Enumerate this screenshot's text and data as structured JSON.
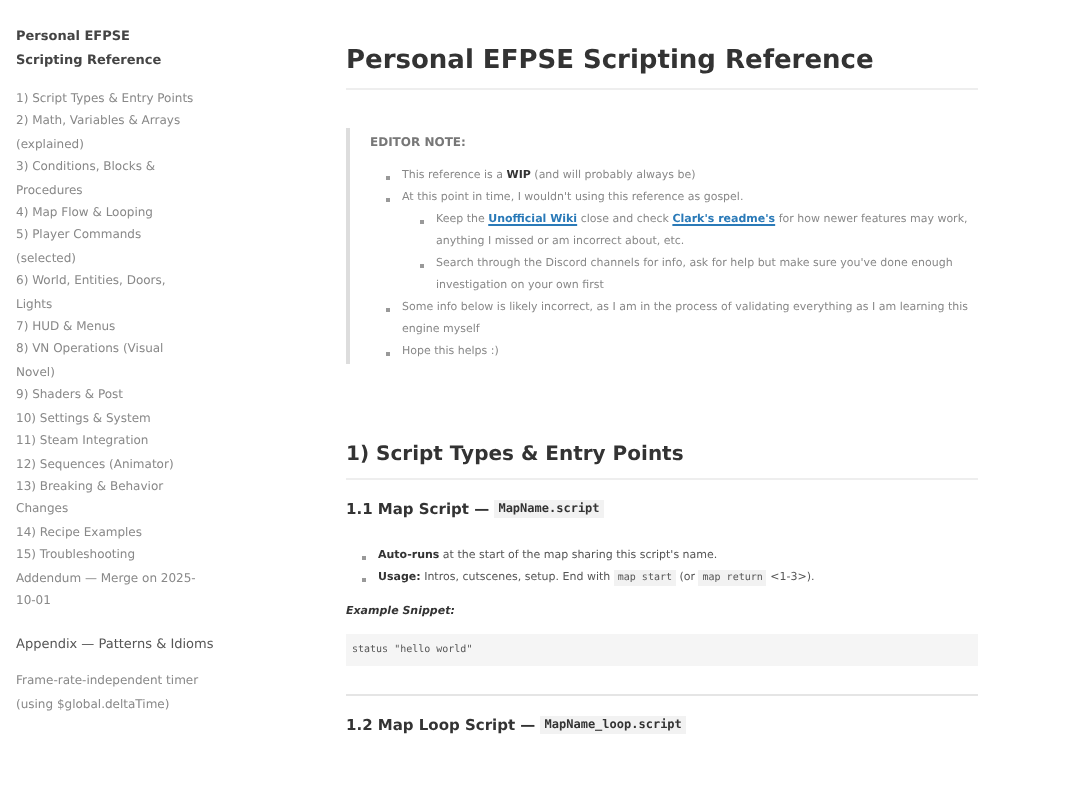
{
  "sidebar": {
    "title": "Personal EFPSE Scripting Reference",
    "items": [
      {
        "label": "1) Script Types & Entry Points"
      },
      {
        "label": "2) Math, Variables & Arrays (explained)"
      },
      {
        "label": "3) Conditions, Blocks & Procedures"
      },
      {
        "label": "4) Map Flow & Looping"
      },
      {
        "label": "5) Player Commands (selected)"
      },
      {
        "label": "6) World, Entities, Doors, Lights"
      },
      {
        "label": "7) HUD & Menus"
      },
      {
        "label": "8) VN Operations (Visual Novel)"
      },
      {
        "label": "9) Shaders & Post"
      },
      {
        "label": "10) Settings & System"
      },
      {
        "label": "11) Steam Integration"
      },
      {
        "label": "12) Sequences (Animator)"
      },
      {
        "label": "13) Breaking & Behavior Changes"
      },
      {
        "label": "14) Recipe Examples"
      },
      {
        "label": "15) Troubleshooting"
      },
      {
        "label": "Addendum — Merge on 2025-10-01"
      }
    ],
    "appendix_title": "Appendix — Patterns & Idioms",
    "appendix_items": [
      {
        "label": "Frame-rate-independent timer (using $global.deltaTime)"
      }
    ]
  },
  "title": "Personal EFPSE Scripting Reference",
  "editor_note": {
    "heading": "EDITOR NOTE:",
    "items": [
      {
        "parts": [
          {
            "kind": "text",
            "text": "This reference is a **WIP** (and will probably always be)"
          }
        ]
      },
      {
        "parts": [
          {
            "kind": "text",
            "text": "At this point in time, I wouldn't using this reference as gospel."
          }
        ],
        "children": [
          {
            "parts": [
              {
                "kind": "text",
                "text": "Keep the "
              },
              {
                "kind": "link",
                "text": "Unofficial Wiki"
              },
              {
                "kind": "text",
                "text": " close and check "
              },
              {
                "kind": "link",
                "text": "Clark's readme's"
              },
              {
                "kind": "text",
                "text": " for how newer features may work, anything I missed or am incorrect about, etc."
              }
            ]
          },
          {
            "parts": [
              {
                "kind": "text",
                "text": "Search through the Discord channels for info, ask for help but make sure you've done enough investigation on your own first"
              }
            ]
          }
        ]
      },
      {
        "parts": [
          {
            "kind": "text",
            "text": "Some info below is likely incorrect, as I am in the process of validating everything as I am learning this engine myself"
          }
        ]
      },
      {
        "parts": [
          {
            "kind": "text",
            "text": "Hope this helps :)"
          }
        ]
      }
    ]
  },
  "section": {
    "heading": "1) Script Types & Entry Points",
    "subsections": [
      {
        "heading": "1.1 Map Script — ",
        "code": "MapName.script",
        "bullets": [
          {
            "parts": [
              {
                "kind": "text",
                "text": "**Auto-runs** at the start of the map sharing this script's name."
              }
            ]
          },
          {
            "parts": [
              {
                "kind": "text",
                "text": "**Usage:** Intros, cutscenes, setup. End with "
              },
              {
                "kind": "code",
                "text": "map start"
              },
              {
                "kind": "text",
                "text": " (or "
              },
              {
                "kind": "code",
                "text": "map return"
              },
              {
                "kind": "text",
                "text": " <1-3>)."
              }
            ]
          }
        ],
        "snippet_label": "Example Snippet:",
        "snippet": "status \"hello world\""
      },
      {
        "heading": "1.2 Map Loop Script — ",
        "code": "MapName_loop.script"
      }
    ]
  }
}
